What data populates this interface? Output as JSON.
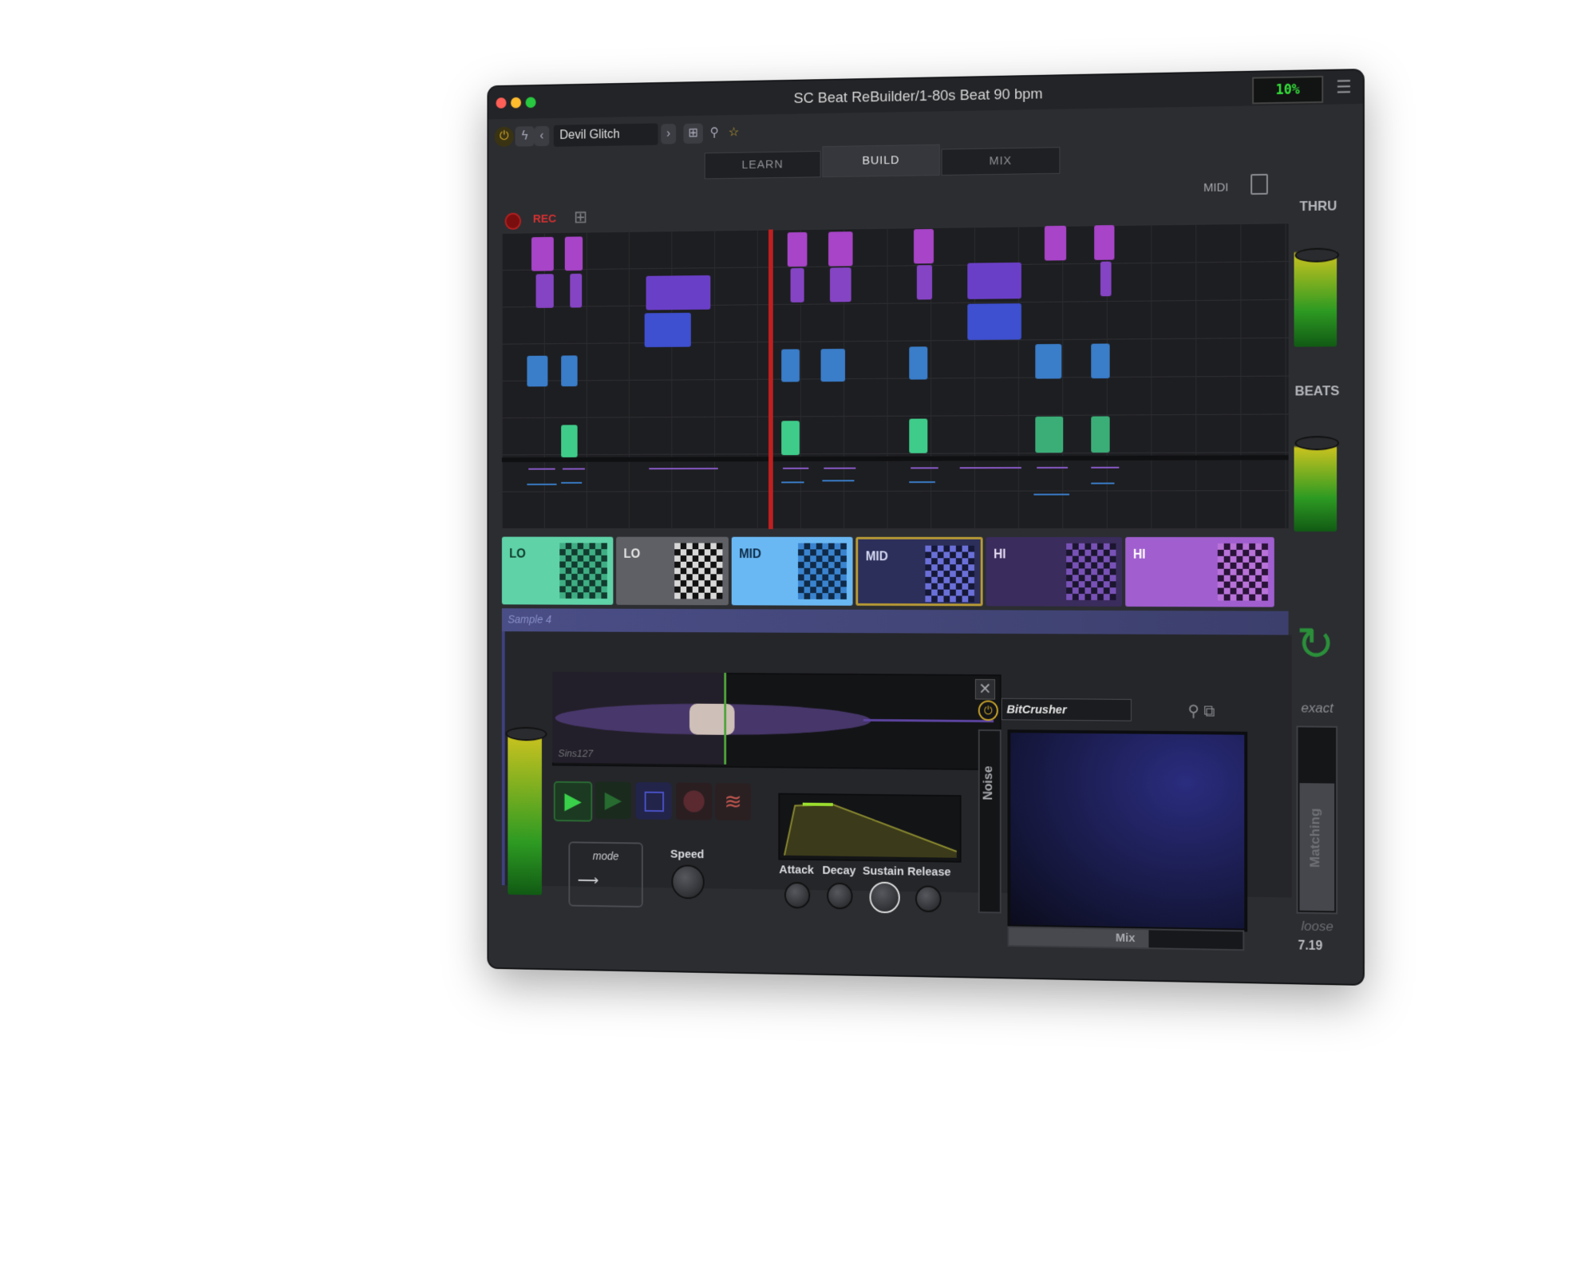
{
  "window": {
    "title": "SC Beat ReBuilder/1-80s Beat 90 bpm",
    "cpu": "10%",
    "menu_icon": "hamburger-icon"
  },
  "toolbar": {
    "preset": "Devil Glitch",
    "icons": [
      "power-icon",
      "bolt-icon",
      "chevron-left-icon",
      "chevron-right-icon",
      "add-icon",
      "search-icon",
      "star-icon"
    ]
  },
  "tabs": [
    "LEARN",
    "BUILD",
    "MIX"
  ],
  "active_tab": "BUILD",
  "sequencer": {
    "rec_label": "REC",
    "midi_label": "MIDI"
  },
  "pads": [
    {
      "label": "LO",
      "color": "#5fd2a8"
    },
    {
      "label": "LO",
      "color": "#5f6065"
    },
    {
      "label": "MID",
      "color": "#6ab8f3"
    },
    {
      "label": "MID",
      "color": "#2c2f5a"
    },
    {
      "label": "HI",
      "color": "#3a2c5c"
    },
    {
      "label": "HI",
      "color": "#a05ecf"
    }
  ],
  "sample": {
    "name": "Sample 4",
    "file": "Sins127",
    "mode_label": "mode",
    "speed_label": "Speed",
    "envelope": {
      "attack": "Attack",
      "decay": "Decay",
      "sustain": "Sustain",
      "release": "Release"
    },
    "fx": {
      "effect": "BitCrusher",
      "noise_label": "Noise",
      "mix_label": "Mix"
    }
  },
  "right_panel": {
    "thru_label": "THRU",
    "beats_label": "BEATS",
    "exact_label": "exact",
    "matching_label": "Matching",
    "loose_label": "loose",
    "version": "7.19"
  }
}
